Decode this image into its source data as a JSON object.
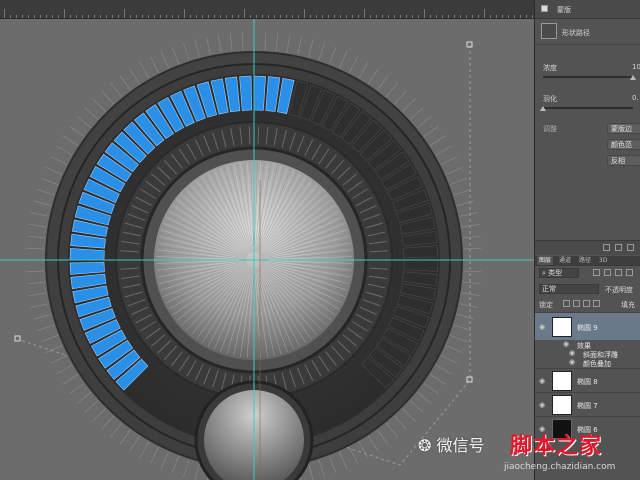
{
  "app": "Photoshop",
  "properties_panel": {
    "title": "蒙版",
    "mask_label": "形状路径",
    "density_label": "浓度",
    "density_value": "10",
    "feather_label": "羽化",
    "feather_value": "0.",
    "adjust_label": "调整",
    "btn_mask_edge": "蒙版边",
    "btn_color_range": "颜色范",
    "btn_invert": "反相"
  },
  "layers_panel": {
    "tabs": [
      "图层",
      "通道",
      "路径",
      "3D"
    ],
    "filter_kind": "类型",
    "blend_mode": "正常",
    "opacity_label": "不透明度",
    "lock_label": "锁定",
    "fill_label": "填充",
    "layers": [
      {
        "name": "椭圆 9",
        "selected": true,
        "thumb": "shape-white"
      },
      {
        "name": "效果",
        "is_effect_header": true
      },
      {
        "name": "斜面和浮雕",
        "is_effect": true
      },
      {
        "name": "颜色叠加",
        "is_effect": true
      },
      {
        "name": "椭圆 8",
        "selected": false,
        "thumb": "shape-white"
      },
      {
        "name": "椭圆 7",
        "selected": false,
        "thumb": "shape-white"
      },
      {
        "name": "椭圆 6",
        "selected": false,
        "thumb": "shape-black"
      }
    ]
  },
  "watermark": {
    "wechat": "微信号",
    "brand": "脚本之家",
    "url": "jiaocheng.chazidian.com"
  },
  "colors": {
    "accent_blue": "#2a8fe6",
    "canvas_bg": "#6e6e6e",
    "guide": "#3fc7c7",
    "brand_red": "#e3162a"
  },
  "knob": {
    "active_segments": 33,
    "total_segments": 60
  }
}
